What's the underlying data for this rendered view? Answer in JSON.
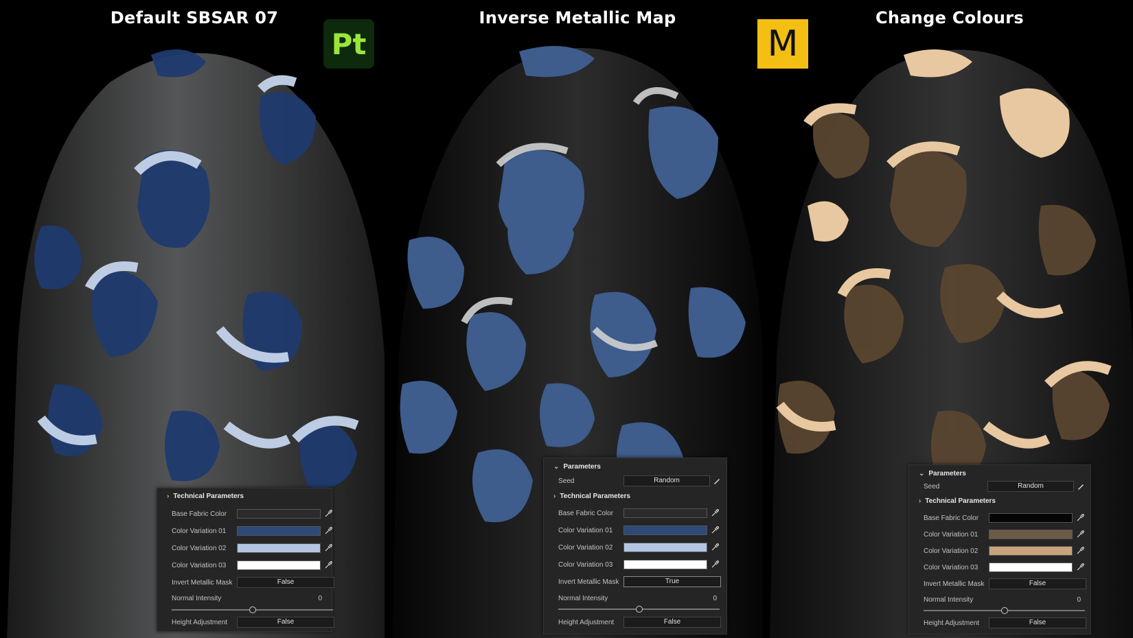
{
  "columns": [
    {
      "id": "default",
      "title": "Default SBSAR 07",
      "colors": {
        "base": "#4a4b4c",
        "v1": "#1f3a6e",
        "v2": "#c5d4ec",
        "v3": "#ffffff",
        "sheen": "#3b5fa0"
      },
      "panel": {
        "technical_label": "Technical Parameters",
        "base_fabric_label": "Base Fabric Color",
        "base_fabric_color": "#2b2b2b",
        "variation01_label": "Color Variation 01",
        "variation01_color": "#2d4a78",
        "variation02_label": "Color Variation 02",
        "variation02_color": "#b4c5e4",
        "variation03_label": "Color Variation 03",
        "variation03_color": "#ffffff",
        "invert_label": "Invert Metallic Mask",
        "invert_value": "False",
        "normal_label": "Normal Intensity",
        "normal_value": "0",
        "normal_fraction": 0.5,
        "height_label": "Height Adjustment",
        "height_value": "False"
      }
    },
    {
      "id": "inverse",
      "title": "Inverse Metallic Map",
      "colors": {
        "base": "#141414",
        "v1": "#3e5c8c",
        "v2": "#c8c8c8",
        "v3": "#e6e6e6",
        "sheen": "#8a8a8a"
      },
      "panel": {
        "params_label": "Parameters",
        "seed_label": "Seed",
        "seed_value": "Random",
        "technical_label": "Technical Parameters",
        "base_fabric_label": "Base Fabric Color",
        "base_fabric_color": "#2b2b2b",
        "variation01_label": "Color Variation 01",
        "variation01_color": "#2d4a78",
        "variation02_label": "Color Variation 02",
        "variation02_color": "#b4c5e4",
        "variation03_label": "Color Variation 03",
        "variation03_color": "#ffffff",
        "invert_label": "Invert Metallic Mask",
        "invert_value": "True",
        "normal_label": "Normal Intensity",
        "normal_value": "0",
        "normal_fraction": 0.5,
        "height_label": "Height Adjustment",
        "height_value": "False"
      }
    },
    {
      "id": "colours",
      "title": "Change Colours",
      "colors": {
        "base": "#1e1e1e",
        "v1": "#5a4630",
        "v2": "#d8b48a",
        "v3": "#f2d3ac",
        "sheen": "#9c7a4e"
      },
      "panel": {
        "params_label": "Parameters",
        "seed_label": "Seed",
        "seed_value": "Random",
        "technical_label": "Technical Parameters",
        "base_fabric_label": "Base Fabric Color",
        "base_fabric_color": "#050505",
        "variation01_label": "Color Variation 01",
        "variation01_color": "#6b5a45",
        "variation02_label": "Color Variation 02",
        "variation02_color": "#c7a47a",
        "variation03_label": "Color Variation 03",
        "variation03_color": "#ffffff",
        "invert_label": "Invert Metallic Mask",
        "invert_value": "False",
        "normal_label": "Normal Intensity",
        "normal_value": "0",
        "normal_fraction": 0.5,
        "height_label": "Height Adjustment",
        "height_value": "False"
      }
    }
  ],
  "logos": {
    "painter": "Pt",
    "max": "M"
  }
}
